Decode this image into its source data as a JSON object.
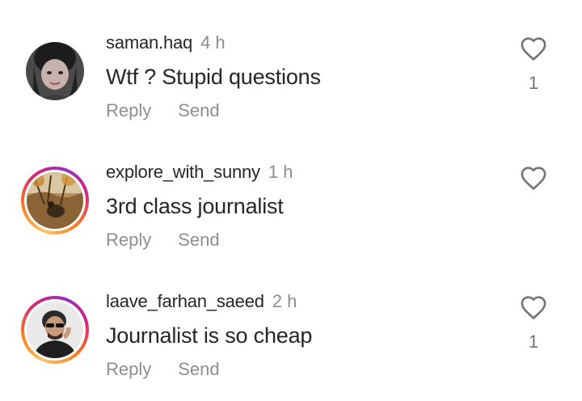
{
  "comments": [
    {
      "username": "saman.haq",
      "time": "4 h",
      "text": "Wtf ? Stupid questions",
      "reply_label": "Reply",
      "send_label": "Send",
      "likes": "1",
      "avatar_ring": false
    },
    {
      "username": "explore_with_sunny",
      "time": "1 h",
      "text": "3rd class journalist",
      "reply_label": "Reply",
      "send_label": "Send",
      "likes": "",
      "avatar_ring": true
    },
    {
      "username": "laave_farhan_saeed",
      "time": "2 h",
      "text": "Journalist is so cheap",
      "reply_label": "Reply",
      "send_label": "Send",
      "likes": "1",
      "avatar_ring": true
    }
  ],
  "icons": {
    "like": "heart-outline-icon"
  },
  "colors": {
    "text": "#262626",
    "muted": "#8e8e8e",
    "story_ring": [
      "#fdc468",
      "#fa7e1e",
      "#d62976",
      "#962fbf"
    ]
  }
}
